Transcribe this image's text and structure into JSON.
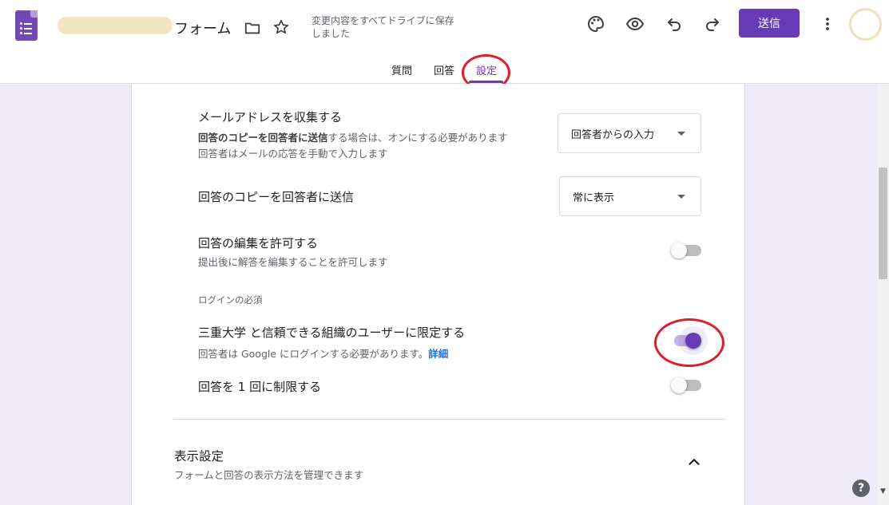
{
  "header": {
    "form_title": "フォーム",
    "save_status": "変更内容をすべてドライブに保存しました",
    "send_label": "送信",
    "icons": [
      "forms-app-icon",
      "folder-icon",
      "star-icon",
      "palette-icon",
      "eye-icon",
      "undo-icon",
      "redo-icon",
      "more-vert-icon"
    ],
    "accent_color": "#673ab7"
  },
  "tabs": [
    {
      "label": "質問",
      "active": false
    },
    {
      "label": "回答",
      "active": false
    },
    {
      "label": "設定",
      "active": true
    }
  ],
  "settings": {
    "collect_email": {
      "title": "メールアドレスを収集する",
      "desc_bold": "回答のコピーを回答者に送信",
      "desc_rest": "する場合は、オンにする必要があります",
      "desc2": "回答者はメールの応答を手動で入力します",
      "dropdown_value": "回答者からの入力"
    },
    "send_copy": {
      "title": "回答のコピーを回答者に送信",
      "dropdown_value": "常に表示"
    },
    "allow_edit": {
      "title": "回答の編集を許可する",
      "desc": "提出後に解答を編集することを許可します",
      "enabled": false
    },
    "login_section_label": "ログインの必須",
    "restrict_org": {
      "title": "三重大学 と信頼できる組織のユーザーに限定する",
      "desc": "回答者は Google にログインする必要があります。",
      "link": "詳細",
      "enabled": true
    },
    "limit_one": {
      "title": "回答を 1 回に制限する",
      "enabled": false
    }
  },
  "display_section": {
    "title": "表示設定",
    "desc": "フォームと回答の表示方法を管理できます"
  },
  "help_label": "?"
}
